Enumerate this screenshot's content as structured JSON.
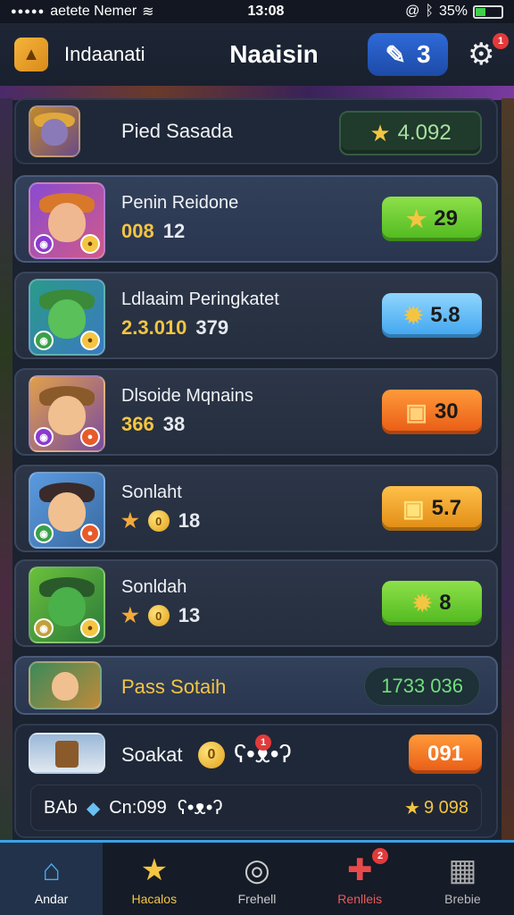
{
  "status_bar": {
    "carrier": "aetete Nemer",
    "time": "13:08",
    "battery": "35%",
    "battery_fraction": 0.35
  },
  "header": {
    "left_label": "Indaanati",
    "title": "Naaisin",
    "count": "3",
    "notification_count": "1"
  },
  "top_entry": {
    "name": "Pied Sasada",
    "value": "4.092"
  },
  "players": [
    {
      "name": "Penin Reidone",
      "stat_a": "008",
      "stat_b": "12",
      "button": "29",
      "button_style": "green",
      "button_glyph": "★"
    },
    {
      "name": "Ldlaaim Peringkatet",
      "stat_a": "2.3.010",
      "stat_b": "379",
      "button": "5.8",
      "button_style": "blue",
      "button_glyph": "✹"
    },
    {
      "name": "Dlsoide Mqnains",
      "stat_a": "366",
      "stat_b": "38",
      "button": "30",
      "button_style": "orange",
      "button_glyph": "▣"
    },
    {
      "name": "Sonlaht",
      "stat_a": "0",
      "stat_b": "18",
      "button": "5.7",
      "button_style": "amber",
      "button_glyph": "▣"
    },
    {
      "name": "Sonldah",
      "stat_a": "0",
      "stat_b": "13",
      "button": "8",
      "button_style": "green",
      "button_glyph": "✹"
    }
  ],
  "pass_entry": {
    "name": "Pass Sotaih",
    "value": "1733 036"
  },
  "bottom_entry": {
    "name": "Soakat",
    "coin": "0",
    "badge": "1",
    "button": "091",
    "sub_label": "BAb",
    "sub_value_label": "Cn:099",
    "sub_value": "9 098"
  },
  "nav": {
    "items": [
      {
        "label": "Andar",
        "icon": "home-icon"
      },
      {
        "label": "Hacalos",
        "icon": "star-icon"
      },
      {
        "label": "Frehell",
        "icon": "compass-icon"
      },
      {
        "label": "Renlleis",
        "icon": "gift-icon",
        "badge": "2"
      },
      {
        "label": "Brebie",
        "icon": "grid-icon"
      }
    ]
  },
  "colors": {
    "accent_blue": "#3aa2e8",
    "gold": "#f4c542",
    "green_value": "#6fe07a"
  }
}
